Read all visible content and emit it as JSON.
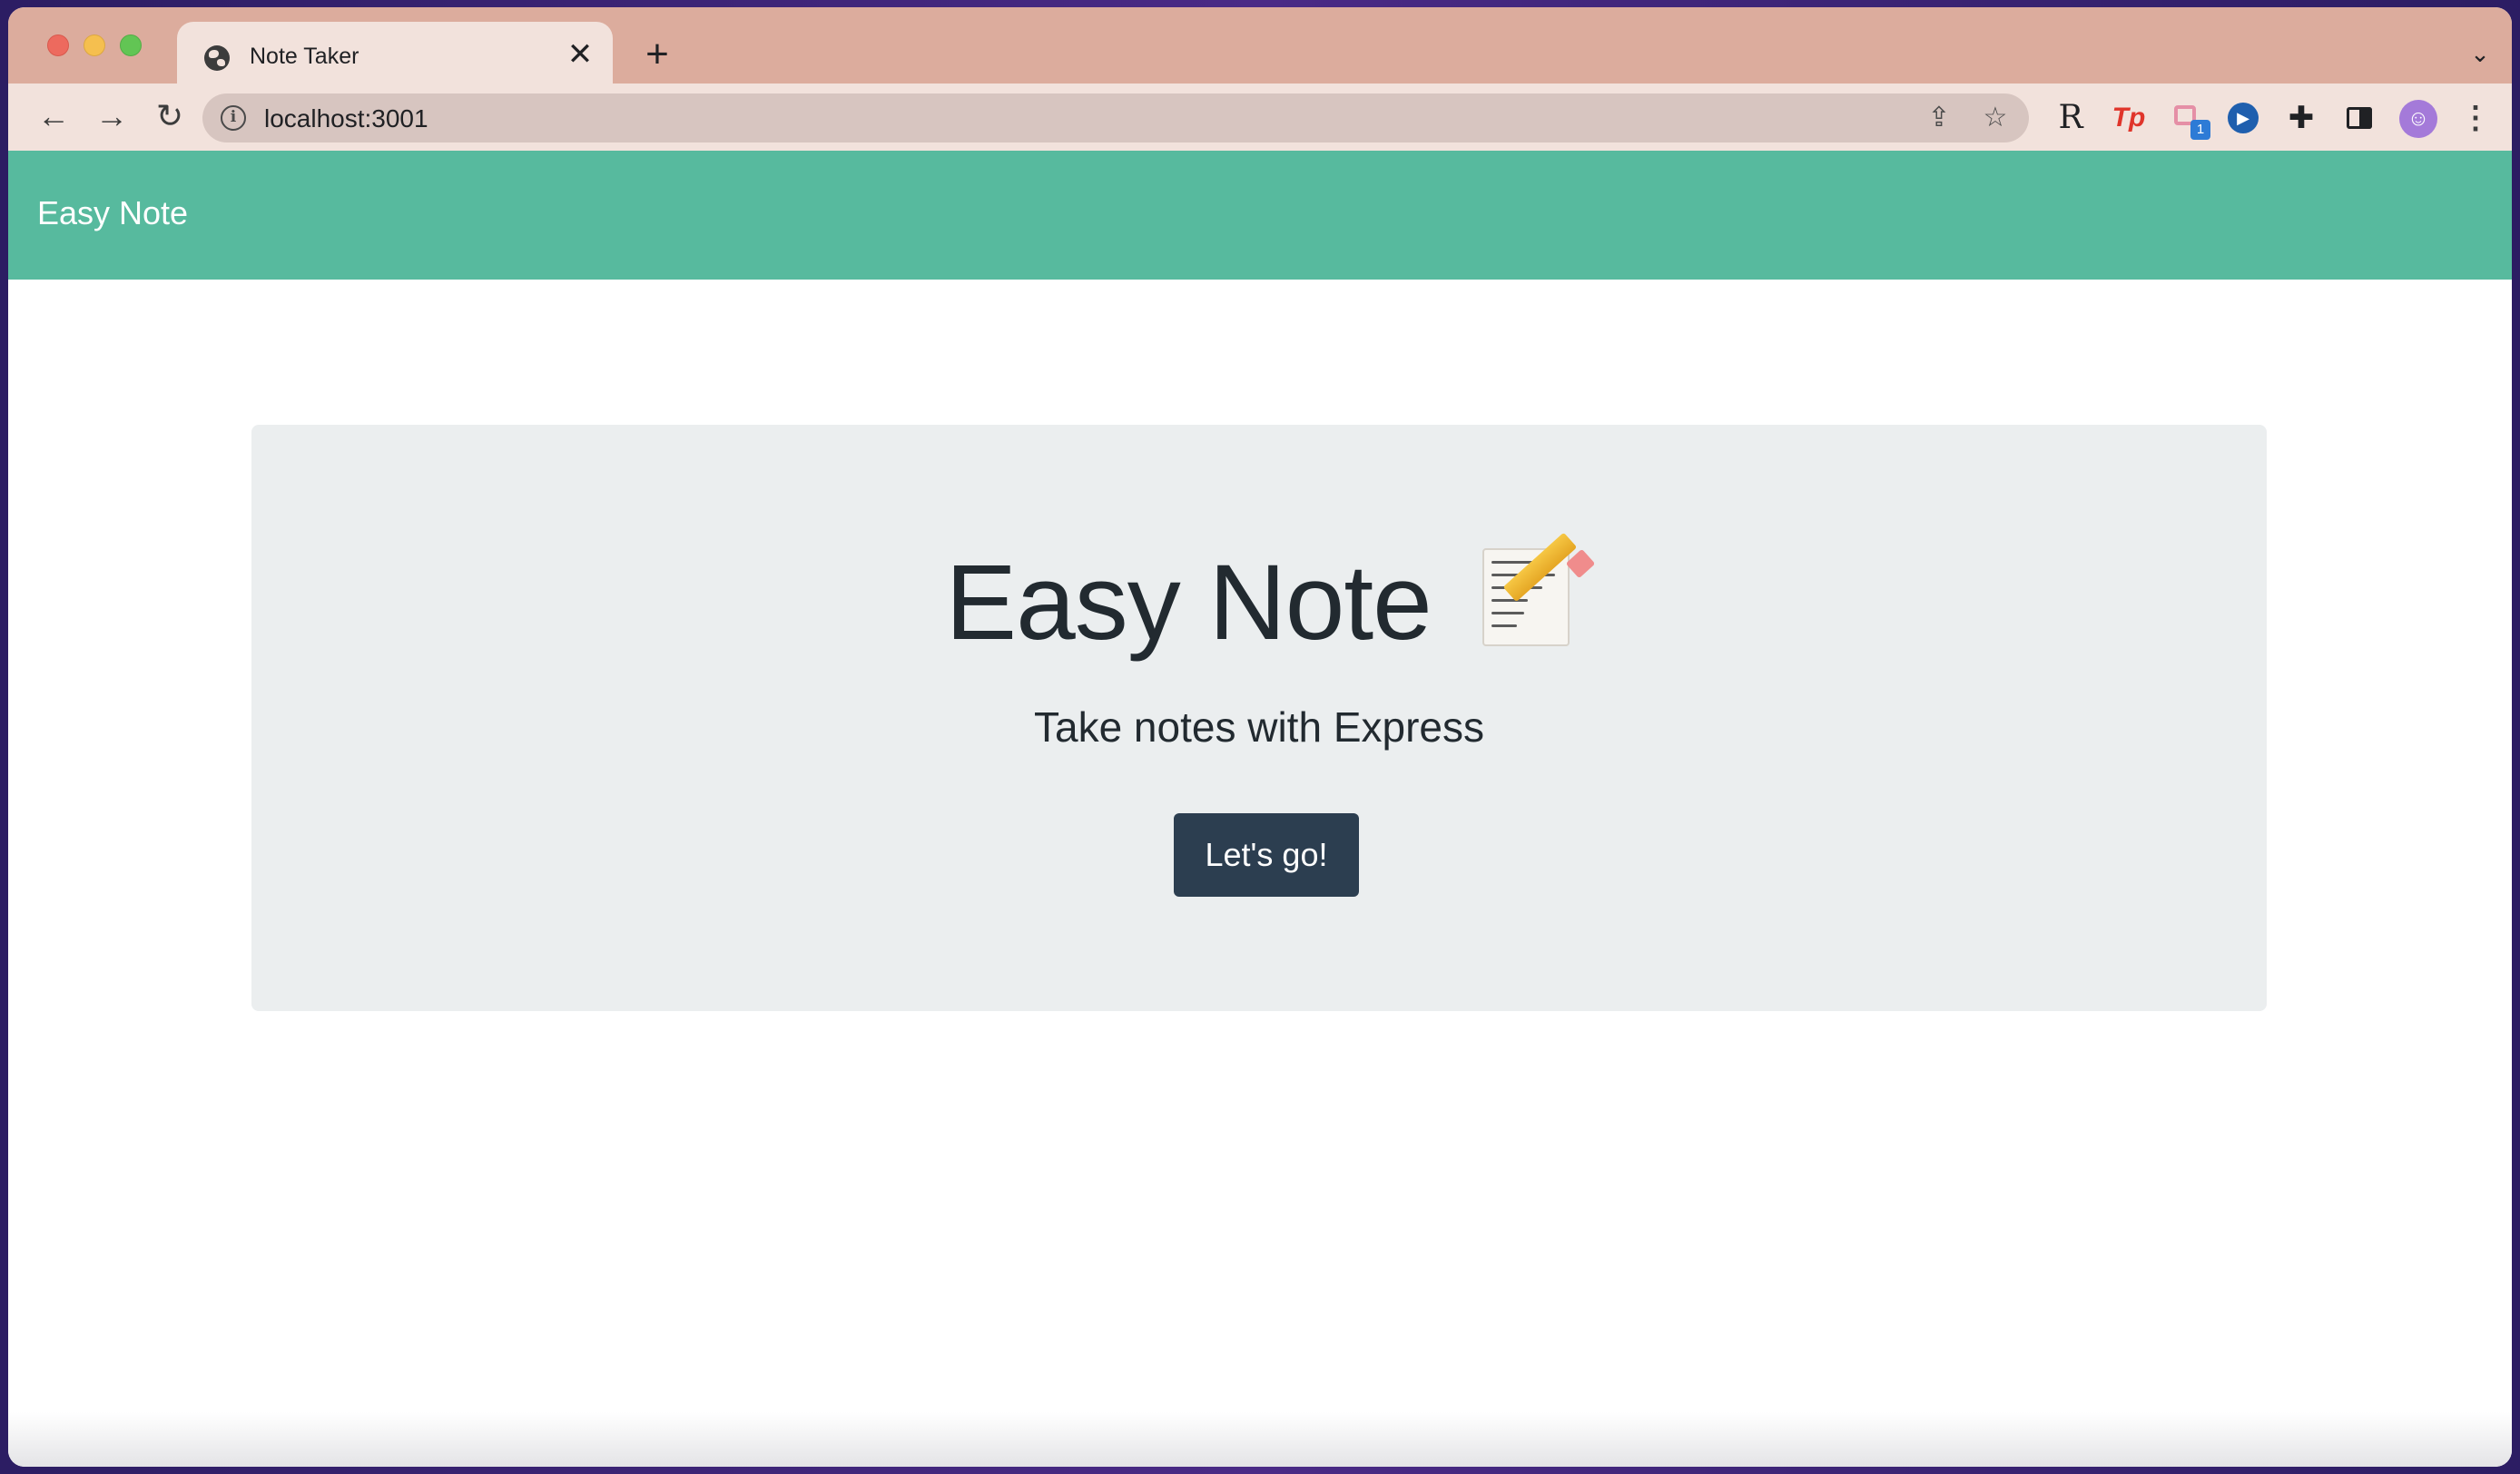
{
  "browser": {
    "tab": {
      "title": "Note Taker",
      "close_glyph": "✕",
      "icon": "globe-icon"
    },
    "new_tab_glyph": "+",
    "tab_list_glyph": "⌄",
    "nav": {
      "back_glyph": "←",
      "forward_glyph": "→",
      "reload_glyph": "↻"
    },
    "address": {
      "url": "localhost:3001",
      "info_glyph": "i"
    },
    "share_glyph": "⇪",
    "bookmark_glyph": "☆",
    "extensions": {
      "r_label": "R",
      "tp_label": "Tp",
      "badge_count": "1",
      "play_glyph": "▶",
      "puzzle_glyph": "✚",
      "avatar_glyph": "☺",
      "menu_glyph": "⋮"
    },
    "colors": {
      "tabstrip": "#dcac9d",
      "toolbar": "#f2e2dc"
    }
  },
  "app": {
    "brand": "Easy Note",
    "hero": {
      "title": "Easy Note",
      "icon": "memo-icon",
      "subtitle": "Take notes with Express",
      "cta_label": "Let's go!"
    },
    "colors": {
      "navbar": "#57ba9e",
      "button": "#2c3e50",
      "jumbotron": "#ebeeef"
    }
  }
}
